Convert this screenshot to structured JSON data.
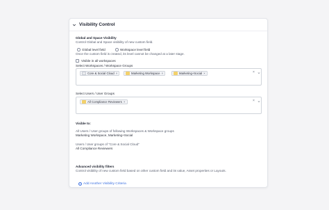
{
  "section": {
    "title": "Visibility Control"
  },
  "global_space": {
    "heading": "Global and Space Visibility",
    "description": "Control Global and Space visibility of new custom field.",
    "option_global": "Global level field",
    "option_workspace": "Workspace level field",
    "note": "Once the custom field is created, its level cannot be changed at a later stage.",
    "selected_option": "Global level field"
  },
  "visible_all": {
    "label": "Visible in all workspaces",
    "checked": false
  },
  "workspaces": {
    "label": "Select Workspaces / Workspace Groups",
    "chips": [
      {
        "label": "Core & Social Cloud",
        "icon": "workspace-icon",
        "icon_color": "#e9eaee"
      },
      {
        "label": "Marketing Workspace",
        "icon": "folder-icon",
        "icon_color": "#f3d16b"
      },
      {
        "label": "Marketing+Social",
        "icon": "folder-icon",
        "icon_color": "#f3d16b"
      }
    ],
    "clear": "×"
  },
  "users": {
    "label": "Select Users / User Groups",
    "chips": [
      {
        "label": "All Compliance Reviewers",
        "icon": "group-icon",
        "icon_color": "#f3d16b"
      }
    ],
    "clear": "×"
  },
  "visible_to": {
    "heading": "Visible to:",
    "line1_label": "All Users / User groups of following Workspaces & Workspace groups",
    "line1_value": "Marketing Workspace, Marketing+Social",
    "line2_label": "Users / User groups of \"Core & Social Cloud\"",
    "line2_value": "All Compliance Reviewers"
  },
  "advanced": {
    "heading": "Advanced visibility filters",
    "description": "Control visibility of new custom field based on other custom field and its value, Asset properties or Layouts.",
    "add_label": "Add Another Visibility Criteria"
  },
  "colors": {
    "accent": "#3b6fe0",
    "chip_folder": "#f3d16b"
  }
}
